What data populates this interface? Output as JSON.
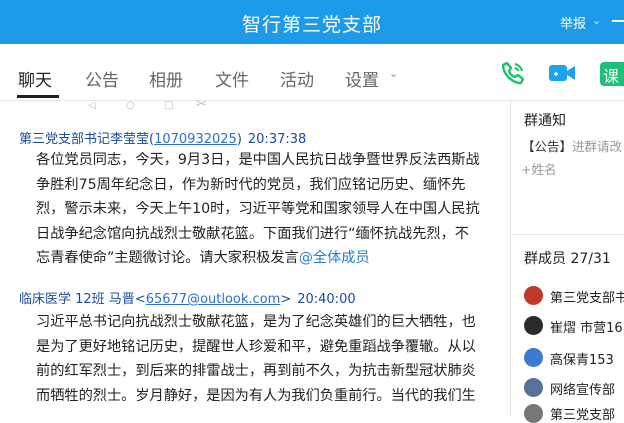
{
  "header": {
    "title": "智行第三党支部",
    "report_label": "举报",
    "report_caret": "⌄"
  },
  "tabs": [
    {
      "label": "聊天",
      "active": true
    },
    {
      "label": "公告"
    },
    {
      "label": "相册"
    },
    {
      "label": "文件"
    },
    {
      "label": "活动"
    },
    {
      "label": "设置"
    }
  ],
  "tab_caret": "⌄",
  "actions": {
    "call_icon": "phone-icon",
    "video_icon": "video-icon",
    "class_label": "课"
  },
  "toolbar": {
    "glyphs": [
      "◁",
      "○",
      "□",
      "✂"
    ]
  },
  "messages": [
    {
      "sender": "第三党支部书记李莹莹",
      "id_open": "(",
      "id": "1070932025",
      "id_close": ")",
      "time": "20:37:38",
      "lines": [
        "各位党员同志，今天，9月3日，是中国人民抗日战争暨世界反法西斯战",
        "争胜利75周年纪念日，作为新时代的党员，我们应铭记历史、缅怀先",
        "烈，警示未来，今天上午10时，习近平等党和国家领导人在中国人民抗",
        "日战争纪念馆向抗战烈士敬献花篮。下面我们进行“缅怀抗战先烈，不",
        "忘青春使命”主题微讨论。请大家积极发言"
      ],
      "mention": "@全体成员"
    },
    {
      "sender": "临床医学 12班 马晋",
      "id_open": "<",
      "id": "65677@outlook.com",
      "id_close": ">",
      "time": "20:40:00",
      "lines": [
        "习近平总书记向抗战烈士敬献花篮，是为了纪念英雄们的巨大牺牲，也",
        "是为了更好地铭记历史，提醒世人珍爱和平，避免重蹈战争覆辙。从以",
        "前的红军烈士，到后来的排雷战士，再到前不久，为抗击新型冠状肺炎",
        "而牺牲的烈士。岁月静好，是因为有人为我们负重前行。当代的我们生"
      ]
    }
  ],
  "sidebar": {
    "notice_title": "群通知",
    "notice_tag": "【公告】",
    "notice_hint": "进群请改",
    "name_tag": "+姓名",
    "members_title": "群成员 27/31",
    "members": [
      {
        "name": "第三党支部书",
        "color": "#c0392b"
      },
      {
        "name": "崔熠 市营16",
        "color": "#2b2b2b"
      },
      {
        "name": "高保青153",
        "color": "#3d7bd1"
      },
      {
        "name": "网络宣传部",
        "color": "#5a6f9a"
      },
      {
        "name": "第三党支部",
        "color": "#777777"
      }
    ]
  },
  "colors": {
    "accent": "#1d9bea",
    "call": "#19c36a",
    "video": "#1aa3f0",
    "class": "#1dbf7a"
  }
}
